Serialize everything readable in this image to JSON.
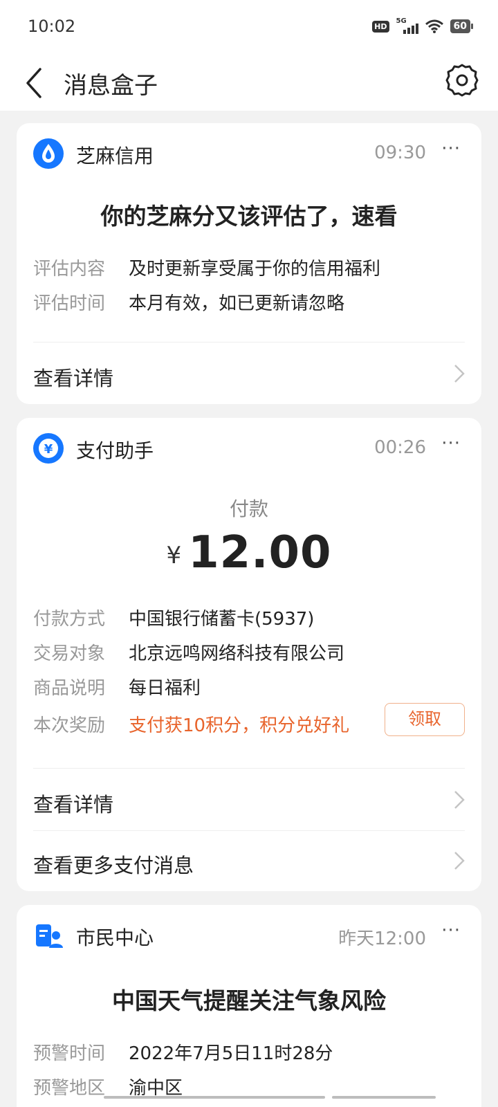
{
  "status_bar": {
    "time": "10:02",
    "hd_label": "HD",
    "network": "5G",
    "battery": "60"
  },
  "nav": {
    "title": "消息盒子",
    "back_icon": "chevron-left-icon",
    "settings_icon": "gear-icon"
  },
  "cards": [
    {
      "app_name": "芝麻信用",
      "icon": "zhima-drop-icon",
      "time": "09:30",
      "more": "···",
      "title": "你的芝麻分又该评估了，速看",
      "rows": [
        {
          "label": "评估内容",
          "value": "及时更新享受属于你的信用福利"
        },
        {
          "label": "评估时间",
          "value": "本月有效，如已更新请忽略"
        }
      ],
      "links": [
        "查看详情"
      ]
    },
    {
      "app_name": "支付助手",
      "icon": "yuan-circle-icon",
      "time": "00:26",
      "more": "···",
      "pay_label": "付款",
      "currency": "¥",
      "amount": "12.00",
      "rows": [
        {
          "label": "付款方式",
          "value": "中国银行储蓄卡(5937)"
        },
        {
          "label": "交易对象",
          "value": "北京远鸣网络科技有限公司"
        },
        {
          "label": "商品说明",
          "value": "每日福利"
        },
        {
          "label": "本次奖励",
          "value": "支付获10积分，积分兑好礼",
          "highlight": true,
          "action": "领取"
        }
      ],
      "links": [
        "查看详情",
        "查看更多支付消息"
      ]
    },
    {
      "app_name": "市民中心",
      "icon": "citizen-center-icon",
      "time": "昨天12:00",
      "more": "···",
      "title": "中国天气提醒关注气象风险",
      "rows": [
        {
          "label": "预警时间",
          "value": "2022年7月5日11时28分"
        },
        {
          "label": "预警地区",
          "value": "渝中区"
        }
      ]
    }
  ],
  "colors": {
    "accent_blue": "#1677ff",
    "orange": "#e8642c",
    "background": "#f2f2f2"
  }
}
